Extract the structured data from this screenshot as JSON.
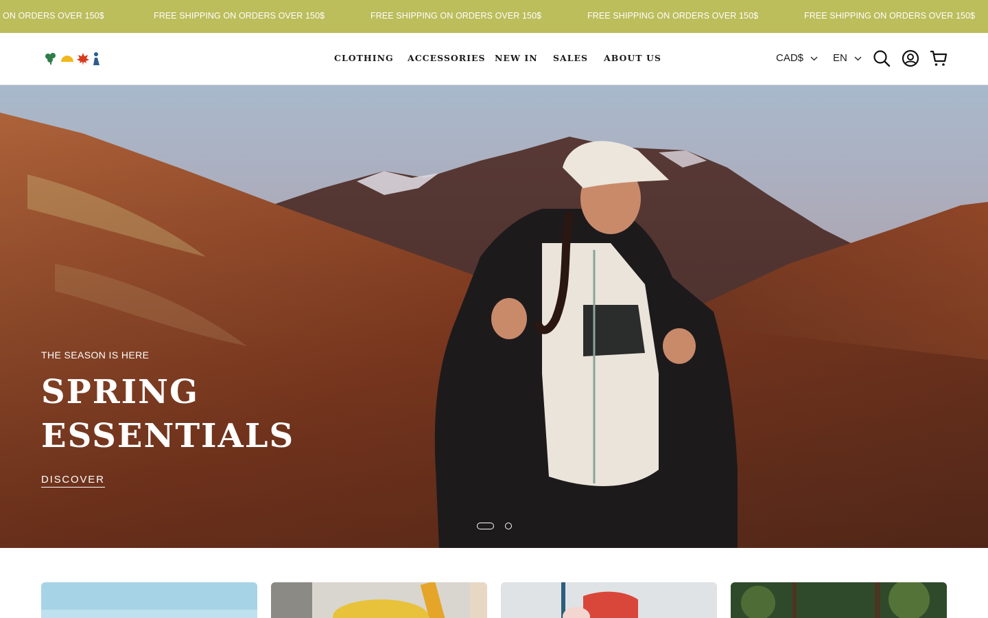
{
  "announcement": {
    "messages": [
      "ON ORDERS OVER 150$",
      "FREE SHIPPING ON ORDERS OVER 150$",
      "FREE SHIPPING ON ORDERS OVER 150$",
      "FREE SHIPPING ON ORDERS OVER 150$",
      "FREE SHIPPING ON ORDERS OVER 150$"
    ],
    "background": "#bcbd5b"
  },
  "header": {
    "logo_icons": [
      "clover-icon",
      "sun-icon",
      "maple-leaf-icon",
      "figure-icon"
    ],
    "nav": [
      "CLOTHING",
      "ACCESSORIES",
      "NEW IN",
      "SALES",
      "ABOUT US"
    ],
    "currency": "CAD$",
    "language": "EN",
    "icons": [
      "search-icon",
      "account-icon",
      "cart-icon"
    ]
  },
  "hero": {
    "eyebrow": "THE SEASON IS HERE",
    "title_line1": "SPRING",
    "title_line2": "ESSENTIALS",
    "cta": "DISCOVER",
    "slide_count": 2,
    "active_slide": 1
  },
  "collections": {
    "card_count": 4
  },
  "colors": {
    "accent": "#bcbd5b",
    "logo_green": "#2e7d4a",
    "logo_yellow": "#f2b71c",
    "logo_red": "#d93a1e",
    "logo_blue": "#2f5d8a"
  }
}
